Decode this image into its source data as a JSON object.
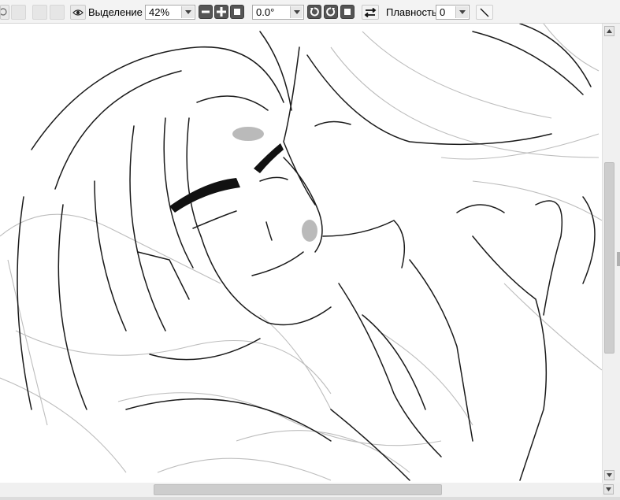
{
  "toolbar": {
    "selection_label": "Выделение",
    "zoom_value": "42%",
    "rotation_value": "0.0°",
    "smoothing_label": "Плавность",
    "smoothing_value": "0"
  },
  "icons": {
    "rotate_ccw": "rotate-ccw-icon",
    "rotate_cw": "rotate-cw-icon",
    "reset": "reset-icon",
    "flip": "flip-horizontal-icon",
    "eye": "eye-icon",
    "line_tool": "line-icon"
  },
  "colors": {
    "toolbar_bg": "#f3f3f3",
    "dark_button": "#555555",
    "canvas_bg": "#ffffff",
    "stroke": "#1a1a1a",
    "sketch": "#b8b8b8",
    "blush": "#9a9a9a"
  },
  "scroll": {
    "vertical_position": 0.42,
    "horizontal_position": 0.4
  }
}
